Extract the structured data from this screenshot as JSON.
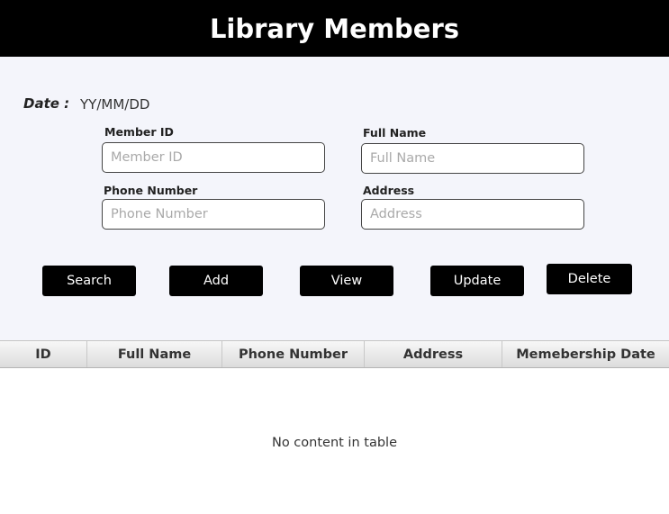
{
  "header": {
    "title": "Library Members"
  },
  "form": {
    "date_label": "Date :",
    "date_value": "YY/MM/DD",
    "fields": {
      "member_id": {
        "label": "Member ID",
        "placeholder": "Member ID",
        "value": ""
      },
      "full_name": {
        "label": "Full Name",
        "placeholder": "Full Name",
        "value": ""
      },
      "phone_number": {
        "label": "Phone Number",
        "placeholder": "Phone Number",
        "value": ""
      },
      "address": {
        "label": "Address",
        "placeholder": "Address",
        "value": ""
      }
    }
  },
  "buttons": {
    "search": "Search",
    "add": "Add",
    "view": "View",
    "update": "Update",
    "delete": "Delete"
  },
  "table": {
    "columns": [
      "ID",
      "Full Name",
      "Phone Number",
      "Address",
      "Memebership Date"
    ],
    "rows": [],
    "empty_message": "No content in table"
  },
  "colors": {
    "header_bg": "#000000",
    "header_text": "#ffffff",
    "form_bg": "#f4f5fb",
    "button_bg": "#000000",
    "button_text": "#ffffff"
  }
}
